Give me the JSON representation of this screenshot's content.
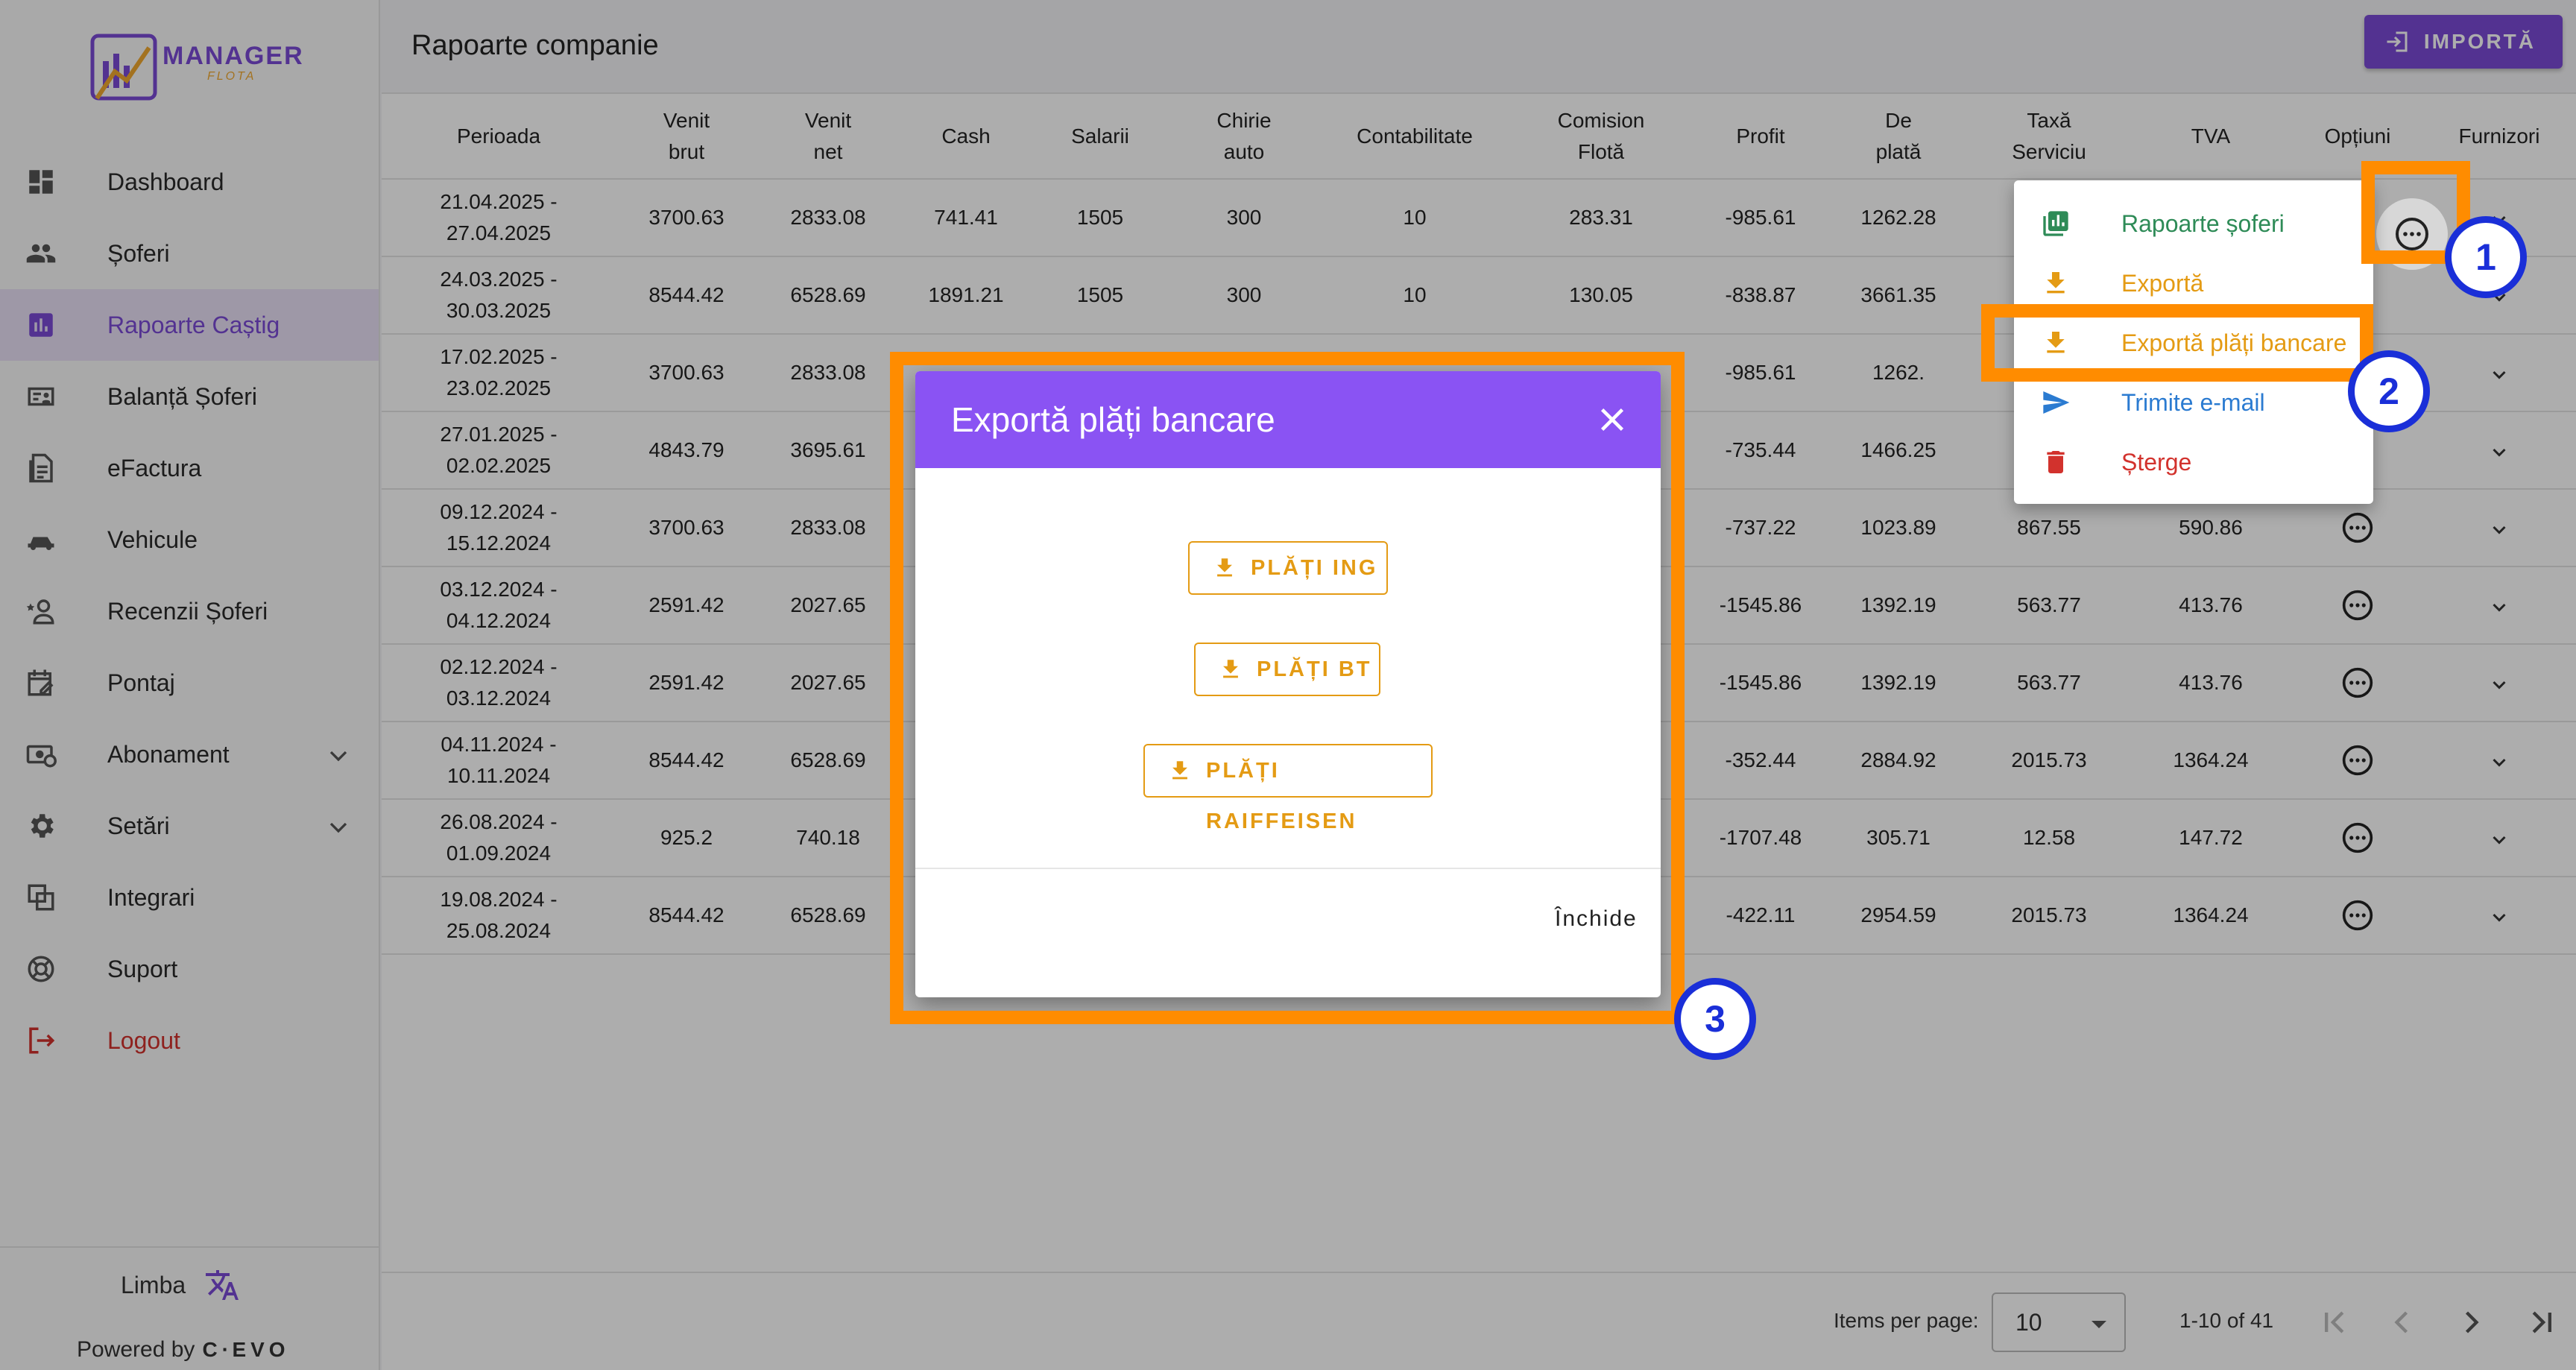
{
  "app": {
    "brand": "MANAGER",
    "brand_sub": "FLOTA"
  },
  "sidebar": {
    "items": [
      {
        "label": "Dashboard",
        "icon": "dashboard-icon"
      },
      {
        "label": "Șoferi",
        "icon": "people-icon"
      },
      {
        "label": "Rapoarte Caștig",
        "icon": "chart-icon",
        "active": true
      },
      {
        "label": "Balanță Șoferi",
        "icon": "id-card-icon"
      },
      {
        "label": "eFactura",
        "icon": "document-icon"
      },
      {
        "label": "Vehicule",
        "icon": "car-icon"
      },
      {
        "label": "Recenzii Șoferi",
        "icon": "person-star-icon"
      },
      {
        "label": "Pontaj",
        "icon": "calendar-edit-icon"
      },
      {
        "label": "Abonament",
        "icon": "money-icon",
        "expandable": true
      },
      {
        "label": "Setări",
        "icon": "gear-icon",
        "expandable": true
      },
      {
        "label": "Integrari",
        "icon": "integration-icon"
      },
      {
        "label": "Suport",
        "icon": "lifebuoy-icon"
      },
      {
        "label": "Logout",
        "icon": "logout-icon"
      }
    ],
    "language_label": "Limba",
    "powered_by": "Powered by",
    "powered_brand": "C∙EVO"
  },
  "header": {
    "title": "Rapoarte companie",
    "import_label": "IMPORTĂ"
  },
  "table": {
    "columns": [
      "Perioada",
      "Venit\nbrut",
      "Venit\nnet",
      "Cash",
      "Salarii",
      "Chirie\nauto",
      "Contabilitate",
      "Comision\nFlotă",
      "Profit",
      "De\nplată",
      "Taxă\nServiciu",
      "TVA",
      "Opțiuni",
      "Furnizori"
    ],
    "rows": [
      [
        "21.04.2025 -\n27.04.2025",
        "3700.63",
        "2833.08",
        "741.41",
        "1505",
        "300",
        "10",
        "283.31",
        "-985.61",
        "1262.28",
        "",
        ""
      ],
      [
        "24.03.2025 -\n30.03.2025",
        "8544.42",
        "6528.69",
        "1891.21",
        "1505",
        "300",
        "10",
        "130.05",
        "-838.87",
        "3661.35",
        "",
        ""
      ],
      [
        "17.02.2025 -\n23.02.2025",
        "3700.63",
        "2833.08",
        "",
        "",
        "",
        "",
        "",
        "-985.61",
        "1262.",
        "",
        ""
      ],
      [
        "27.01.2025 -\n02.02.2025",
        "4843.79",
        "3695.61",
        "",
        "",
        "",
        "",
        "",
        "-735.44",
        "1466.25",
        "",
        ""
      ],
      [
        "09.12.2024 -\n15.12.2024",
        "3700.63",
        "2833.08",
        "",
        "",
        "",
        "",
        "",
        "-737.22",
        "1023.89",
        "867.55",
        "590.86"
      ],
      [
        "03.12.2024 -\n04.12.2024",
        "2591.42",
        "2027.65",
        "",
        "",
        "",
        "",
        "",
        "-1545.86",
        "1392.19",
        "563.77",
        "413.76"
      ],
      [
        "02.12.2024 -\n03.12.2024",
        "2591.42",
        "2027.65",
        "",
        "",
        "",
        "",
        "",
        "-1545.86",
        "1392.19",
        "563.77",
        "413.76"
      ],
      [
        "04.11.2024 -\n10.11.2024",
        "8544.42",
        "6528.69",
        "",
        "",
        "",
        "",
        "",
        "-352.44",
        "2884.92",
        "2015.73",
        "1364.24"
      ],
      [
        "26.08.2024 -\n01.09.2024",
        "925.2",
        "740.18",
        "",
        "",
        "",
        "",
        "",
        "-1707.48",
        "305.71",
        "12.58",
        "147.72"
      ],
      [
        "19.08.2024 -\n25.08.2024",
        "8544.42",
        "6528.69",
        "",
        "",
        "",
        "",
        "",
        "-422.11",
        "2954.59",
        "2015.73",
        "1364.24"
      ]
    ]
  },
  "pagination": {
    "items_per_page_label": "Items per page:",
    "items_per_page": "10",
    "range": "1-10 of 41"
  },
  "options_menu": {
    "items": [
      {
        "label": "Rapoarte șoferi",
        "color": "#2e8b57"
      },
      {
        "label": "Exportă",
        "color": "#e49b14"
      },
      {
        "label": "Exportă plăți bancare",
        "color": "#e49b14"
      },
      {
        "label": "Trimite e-mail",
        "color": "#2b7bd1"
      },
      {
        "label": "Șterge",
        "color": "#d2322d"
      }
    ]
  },
  "dialog": {
    "title": "Exportă plăți bancare",
    "buttons": [
      "PLĂȚI ING",
      "PLĂȚI BT",
      "PLĂȚI RAIFFEISEN"
    ],
    "close_label": "Închide"
  },
  "annotations": {
    "badges": [
      "1",
      "2",
      "3"
    ],
    "highlight_color": "#ff8c00",
    "badge_color": "#1a2fd8"
  },
  "colors": {
    "accent": "#7b4bd6",
    "dialog_header": "#8a53f3",
    "orange": "#e49b14"
  }
}
